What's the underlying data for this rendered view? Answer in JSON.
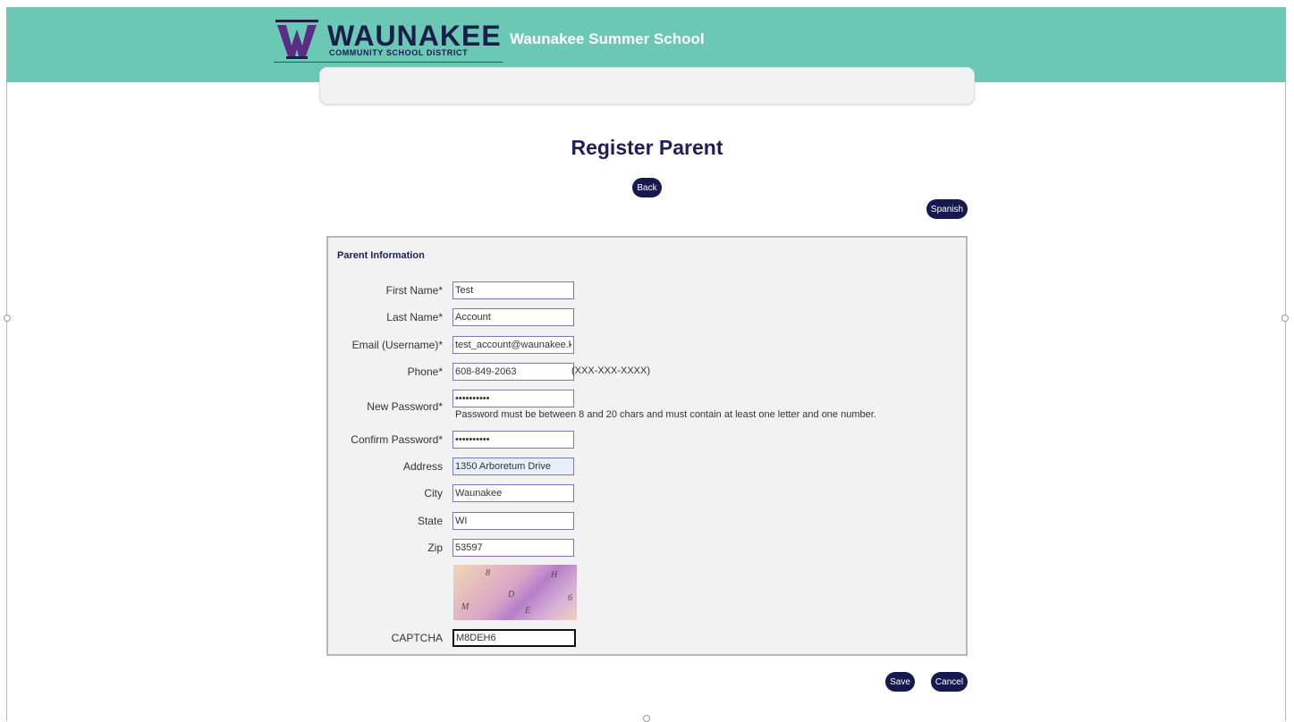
{
  "header": {
    "logo_mark": "W",
    "logo_name": "WAUNAKEE",
    "logo_subtitle": "COMMUNITY SCHOOL DISTRICT",
    "site_title": "Waunakee Summer School",
    "bg_color": "#6bc8b4"
  },
  "page": {
    "title": "Register Parent",
    "back_label": "Back",
    "spanish_label": "Spanish"
  },
  "form": {
    "legend": "Parent Information",
    "first_name": {
      "label": "First Name*",
      "value": "Test"
    },
    "last_name": {
      "label": "Last Name*",
      "value": "Account"
    },
    "email": {
      "label": "Email (Username)*",
      "value": "test_account@waunakee.k"
    },
    "phone": {
      "label": "Phone*",
      "value": "608-849-2063",
      "hint": "(XXX-XXX-XXXX)"
    },
    "new_password": {
      "label": "New Password*",
      "value": "••••••••••",
      "hint": "Password must be between 8 and 20 chars and must contain at least one letter and one number."
    },
    "confirm_password": {
      "label": "Confirm Password*",
      "value": "••••••••••"
    },
    "address": {
      "label": "Address",
      "value": "1350 Arboretum Drive"
    },
    "city": {
      "label": "City",
      "value": "Waunakee"
    },
    "state": {
      "label": "State",
      "value": "WI"
    },
    "zip": {
      "label": "Zip",
      "value": "53597"
    },
    "captcha_chars": [
      "8",
      "H",
      "D",
      "6",
      "M",
      "E"
    ],
    "captcha": {
      "label": "CAPTCHA",
      "value": "M8DEH6"
    }
  },
  "actions": {
    "save_label": "Save",
    "cancel_label": "Cancel",
    "button_color": "#16194f"
  }
}
